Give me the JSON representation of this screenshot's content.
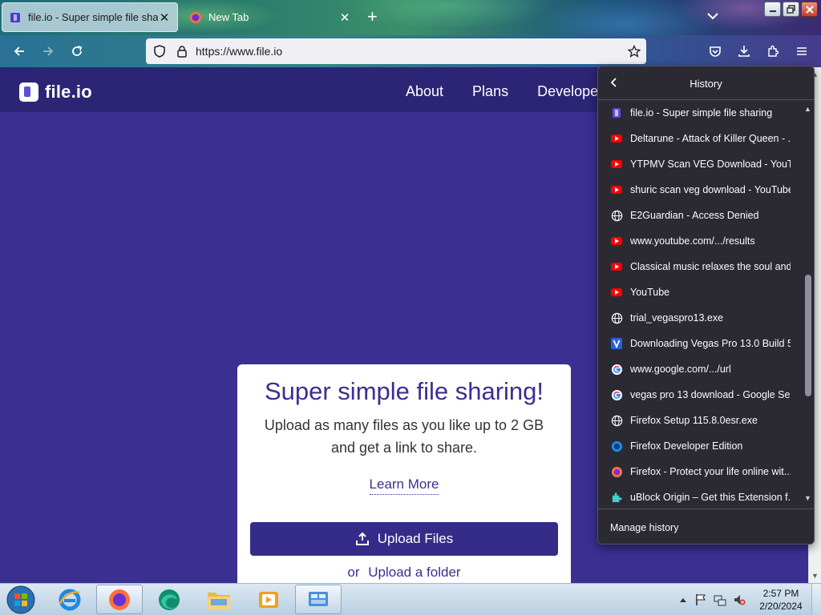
{
  "browser": {
    "tabs": [
      {
        "title": "file.io - Super simple file sharing",
        "close": "✕",
        "active": true
      },
      {
        "title": "New Tab",
        "close": "✕",
        "active": false
      }
    ],
    "new_tab": "+",
    "address": "https://www.file.io",
    "icons": [
      "back-icon",
      "forward-icon",
      "reload-icon",
      "shield-icon",
      "lock-icon",
      "star-icon",
      "pocket-icon",
      "download-icon",
      "extensions-icon",
      "menu-icon"
    ]
  },
  "page": {
    "logo": "file.io",
    "nav": [
      "About",
      "Plans",
      "Developers"
    ],
    "card": {
      "headline": "Super simple file sharing!",
      "subtitle": "Upload as many files as you like up to 2 GB and get a link to share.",
      "learn_more": "Learn More",
      "upload_button": "Upload Files",
      "or": "or",
      "upload_folder": "Upload a folder"
    },
    "colors": {
      "brand": "#3b2f91",
      "header": "#2c2575",
      "button": "#352c8a"
    }
  },
  "history": {
    "title": "History",
    "items": [
      {
        "label": "file.io - Super simple file sharing",
        "icon": "fileio"
      },
      {
        "label": "Deltarune - Attack of Killer Queen - ...",
        "icon": "youtube"
      },
      {
        "label": "YTPMV Scan VEG Download - YouT...",
        "icon": "youtube"
      },
      {
        "label": "shuric scan veg download - YouTube",
        "icon": "youtube"
      },
      {
        "label": "E2Guardian - Access Denied",
        "icon": "globe"
      },
      {
        "label": "www.youtube.com/.../results",
        "icon": "youtube"
      },
      {
        "label": "Classical music relaxes the soul and...",
        "icon": "youtube"
      },
      {
        "label": "YouTube",
        "icon": "youtube"
      },
      {
        "label": "trial_vegaspro13.exe",
        "icon": "globe"
      },
      {
        "label": "Downloading Vegas Pro 13.0 Build 5...",
        "icon": "vegas"
      },
      {
        "label": "www.google.com/.../url",
        "icon": "google"
      },
      {
        "label": "vegas pro 13 download - Google Se...",
        "icon": "google"
      },
      {
        "label": "Firefox Setup 115.8.0esr.exe",
        "icon": "globe"
      },
      {
        "label": "Firefox Developer Edition",
        "icon": "firefox-dev"
      },
      {
        "label": "Firefox - Protect your life online wit...",
        "icon": "firefox"
      },
      {
        "label": "uBlock Origin – Get this Extension f...",
        "icon": "extension"
      }
    ],
    "manage": "Manage history"
  },
  "taskbar": {
    "apps": [
      "internet-explorer",
      "firefox",
      "edge",
      "file-explorer",
      "media-player",
      "control-panel"
    ],
    "time": "2:57 PM",
    "date": "2/20/2024"
  }
}
